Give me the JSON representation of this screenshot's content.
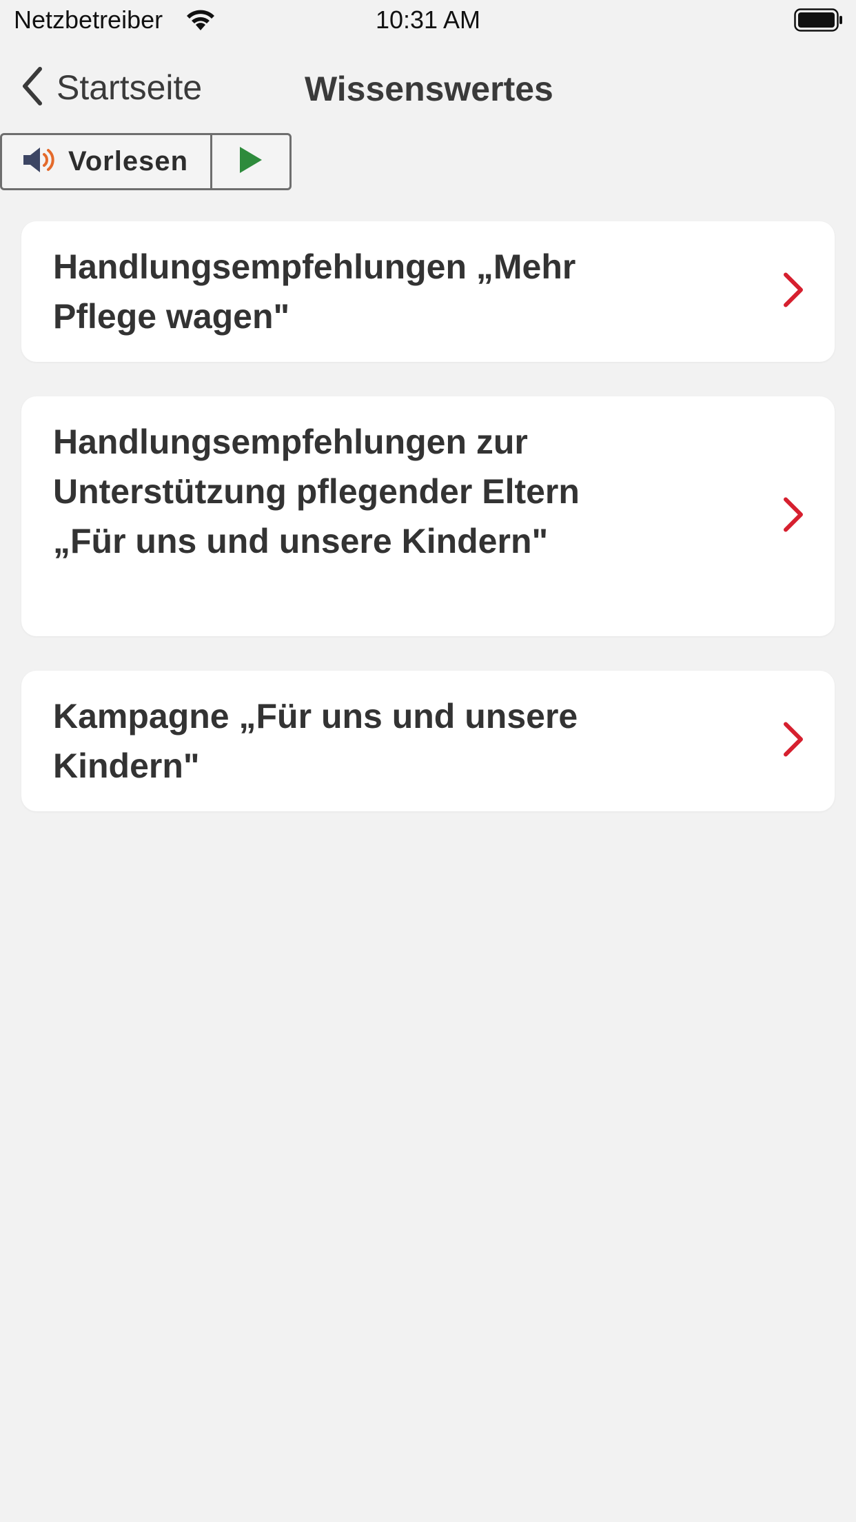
{
  "status": {
    "carrier": "Netzbetreiber",
    "time": "10:31 AM"
  },
  "nav": {
    "back_label": "Startseite",
    "title": "Wissenswertes"
  },
  "reader": {
    "label": "Vorlesen"
  },
  "items": [
    {
      "label": "Handlungsempfehlungen „Mehr Pflege wagen\""
    },
    {
      "label": "Handlungsempfehlungen zur Unterstützung pflegender Eltern „Für uns und unsere Kindern\""
    },
    {
      "label": "Kampagne „Für uns und unsere Kindern\""
    }
  ],
  "colors": {
    "accent": "#d6202f",
    "play": "#2e8b3c",
    "speaker": "#3c4563",
    "speaker_waves": "#e46a2b"
  }
}
